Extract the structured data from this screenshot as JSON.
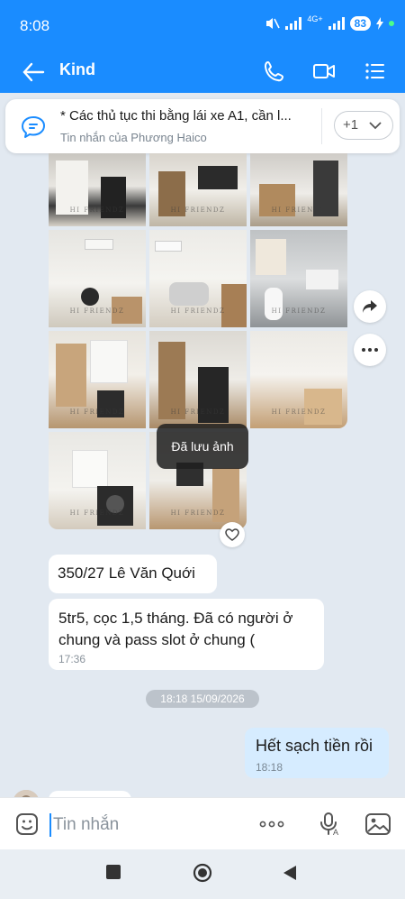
{
  "status_bar": {
    "time": "8:08",
    "network": "4G+",
    "battery": "83"
  },
  "header": {
    "title": "Kind",
    "icons": [
      "back-arrow-icon",
      "phone-icon",
      "video-call-icon",
      "menu-list-icon"
    ]
  },
  "pinned_message": {
    "text": "* Các thủ tục thi bằng lái xe A1, cần l...",
    "subtitle": "Tin nhắn của Phương Haico",
    "more_label": "+1"
  },
  "photo_grid": {
    "watermark": "HI FRIENDZ",
    "photo_count": 11
  },
  "toast": "Đã lưu ảnh",
  "messages": [
    {
      "text": "350/27 Lê Văn Quới",
      "time": ""
    },
    {
      "text": "5tr5, cọc 1,5 tháng. Đã có người ở chung và pass slot ở chung (",
      "time": "17:36"
    }
  ],
  "date_separator": "18:18 15/09/2026",
  "my_message": {
    "text": "Hết sạch tiền rồi",
    "time": "18:18"
  },
  "input": {
    "placeholder": "Tin nhắn"
  },
  "colors": {
    "accent": "#1a8cff",
    "chat_background": "#e2e9f1",
    "my_bubble": "#d6ecff"
  }
}
